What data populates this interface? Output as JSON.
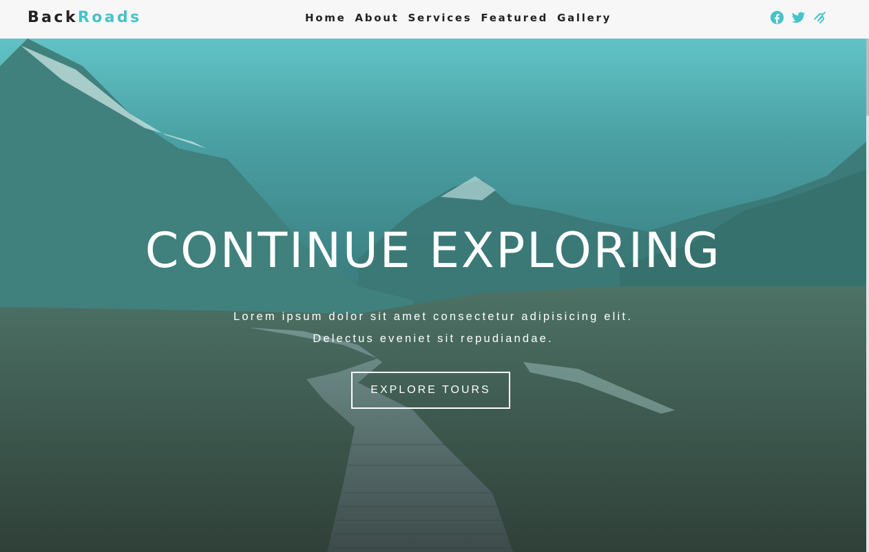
{
  "brand": {
    "part1": "Back",
    "part2": "Roads"
  },
  "nav": {
    "items": [
      "Home",
      "About",
      "Services",
      "Featured",
      "Gallery"
    ]
  },
  "social": {
    "icons": [
      "facebook-icon",
      "twitter-icon",
      "squarespace-icon"
    ]
  },
  "hero": {
    "title": "CONTINUE EXPLORING",
    "line1": "Lorem ipsum dolor sit amet consectetur adipisicing elit.",
    "line2": "Delectus eveniet sit repudiandae.",
    "cta_label": "EXPLORE TOURS"
  },
  "colors": {
    "accent": "#45c4c9",
    "text_dark": "#222222",
    "navbar_bg": "#f7f7f7",
    "hero_tint": "#4fb9bb"
  }
}
